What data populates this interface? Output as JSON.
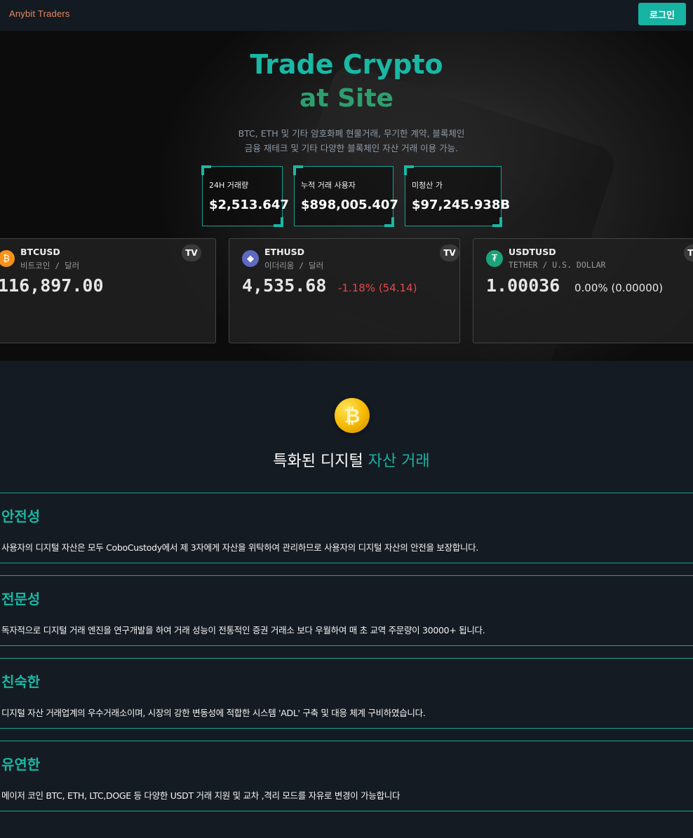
{
  "header": {
    "brand": "Anybit Traders",
    "login_label": "로그인"
  },
  "hero": {
    "title_line1": "Trade Crypto",
    "title_line2": "at Site",
    "subtitle_line1": "BTC, ETH 및 기타 암호화폐 현물거래, 무기한 계약, 블록체인",
    "subtitle_line2": "금융 재테크 및 기타 다양한 블록체인 자산 거래 이용 가능.",
    "stats": [
      {
        "label": "24H 거래량",
        "value": "$2,513.647"
      },
      {
        "label": "누적 거래 사용자",
        "value": "$898,005.407"
      },
      {
        "label": "미청산 가",
        "value": "$97,245.938B"
      }
    ]
  },
  "tickers": [
    {
      "symbol": "BTCUSD",
      "name": "비트코인 / 달러",
      "price": "116,897.00",
      "change": "",
      "icon": "bitcoin-icon"
    },
    {
      "symbol": "ETHUSD",
      "name": "이더리움 / 달러",
      "price": "4,535.68",
      "change": "-1.18% (54.14)",
      "icon": "ethereum-icon"
    },
    {
      "symbol": "USDTUSD",
      "name": "TETHER / U.S. DOLLAR",
      "price": "1.00036",
      "change": "0.00% (0.00000)",
      "icon": "tether-icon"
    }
  ],
  "tv_badge": "TV",
  "features": {
    "title_prefix": "특화된 디지털 ",
    "title_highlight": "자산 거래",
    "items": [
      {
        "heading": "안전성",
        "text": "사용자의 디지털 자산은 모두 CoboCustody에서 제 3자에게 자산을 위탁하여 관리하므로 사용자의 디지털 자산의 안전을 보장합니다."
      },
      {
        "heading": "전문성",
        "text": "독자적으로 디지털 거래 엔진을 연구개발을 하여 거래 성능이 전통적인 증권 거래소 보다 우월하여 매 초 교역 주문량이 30000+ 됩니다."
      },
      {
        "heading": "친숙한",
        "text": "디지털 자산 거래업계의 우수거래소이며, 시장의 강한 변동성에 적합한 시스템 'ADL' 구축 및 대응 체계 구비하였습니다."
      },
      {
        "heading": "유연한",
        "text": "메이저 코인 BTC, ETH, LTC,DOGE 등 다양한 USDT 거래 지원 및 교차 ,격리 모드를 자유로 변경이 가능합니다"
      }
    ]
  },
  "colors": {
    "accent": "#17b3a3",
    "brand": "#e58a63",
    "negative": "#e5484d",
    "neutral_change": "#e6e6e6"
  }
}
